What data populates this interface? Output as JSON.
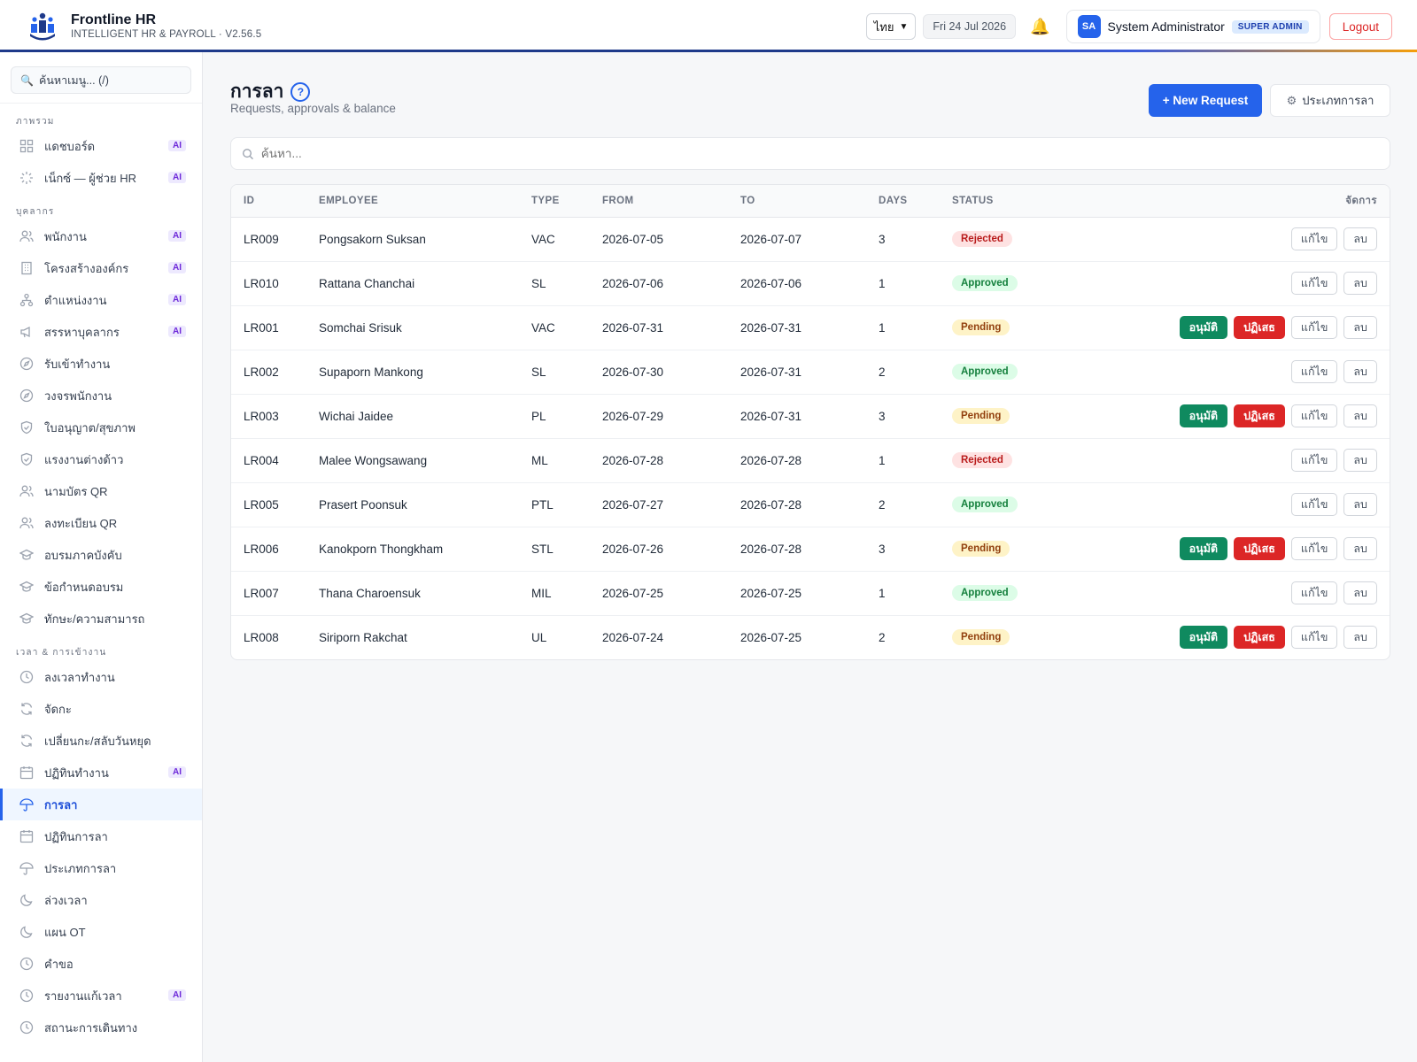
{
  "header": {
    "brand_name": "Frontline HR",
    "brand_sub": "INTELLIGENT HR & PAYROLL · V2.56.5",
    "language": "ไทย",
    "date": "Fri 24 Jul 2026",
    "user_initials": "SA",
    "user_name": "System Administrator",
    "user_role": "SUPER ADMIN",
    "logout": "Logout"
  },
  "sidebar": {
    "search_placeholder": "ค้นหาเมนู... (/)",
    "ai_label": "AI",
    "sections": [
      {
        "title": "ภาพรวม",
        "items": [
          {
            "label": "แดชบอร์ด",
            "icon": "dashboard-icon",
            "ai": true
          },
          {
            "label": "เน็กซ์ — ผู้ช่วย HR",
            "icon": "sparkle-icon",
            "ai": true
          }
        ]
      },
      {
        "title": "บุคลากร",
        "items": [
          {
            "label": "พนักงาน",
            "icon": "users-icon",
            "ai": true
          },
          {
            "label": "โครงสร้างองค์กร",
            "icon": "building-icon",
            "ai": true
          },
          {
            "label": "ตำแหน่งงาน",
            "icon": "org-chart-icon",
            "ai": true
          },
          {
            "label": "สรรหาบุคลากร",
            "icon": "megaphone-icon",
            "ai": true
          },
          {
            "label": "รับเข้าทำงาน",
            "icon": "compass-icon",
            "ai": false
          },
          {
            "label": "วงจรพนักงาน",
            "icon": "compass-icon",
            "ai": false
          },
          {
            "label": "ใบอนุญาต/สุขภาพ",
            "icon": "shield-icon",
            "ai": false
          },
          {
            "label": "แรงงานต่างด้าว",
            "icon": "shield-icon",
            "ai": false
          },
          {
            "label": "นามบัตร QR",
            "icon": "users-icon",
            "ai": false
          },
          {
            "label": "ลงทะเบียน QR",
            "icon": "users-icon",
            "ai": false
          },
          {
            "label": "อบรมภาคบังคับ",
            "icon": "graduation-cap-icon",
            "ai": false
          },
          {
            "label": "ข้อกำหนดอบรม",
            "icon": "graduation-cap-icon",
            "ai": false
          },
          {
            "label": "ทักษะ/ความสามารถ",
            "icon": "graduation-cap-icon",
            "ai": false
          }
        ]
      },
      {
        "title": "เวลา & การเข้างาน",
        "items": [
          {
            "label": "ลงเวลาทำงาน",
            "icon": "clock-icon",
            "ai": false
          },
          {
            "label": "จัดกะ",
            "icon": "refresh-icon",
            "ai": false
          },
          {
            "label": "เปลี่ยนกะ/สลับวันหยุด",
            "icon": "refresh-icon",
            "ai": false
          },
          {
            "label": "ปฏิทินทำงาน",
            "icon": "calendar-icon",
            "ai": true
          },
          {
            "label": "การลา",
            "icon": "umbrella-icon",
            "ai": false,
            "active": true
          },
          {
            "label": "ปฏิทินการลา",
            "icon": "calendar-icon",
            "ai": false
          },
          {
            "label": "ประเภทการลา",
            "icon": "umbrella-icon",
            "ai": false
          },
          {
            "label": "ล่วงเวลา",
            "icon": "moon-icon",
            "ai": false
          },
          {
            "label": "แผน OT",
            "icon": "moon-icon",
            "ai": false
          },
          {
            "label": "คำขอ",
            "icon": "clock-icon",
            "ai": false
          },
          {
            "label": "รายงานแก้เวลา",
            "icon": "clock-icon",
            "ai": true
          },
          {
            "label": "สถานะการเดินทาง",
            "icon": "clock-icon",
            "ai": false
          }
        ]
      }
    ]
  },
  "main": {
    "title": "การลา",
    "subtitle": "Requests, approvals & balance",
    "new_request": "+ New Request",
    "leave_types": "ประเภทการลา",
    "search_placeholder": "ค้นหา...",
    "columns": {
      "id": "ID",
      "employee": "EMPLOYEE",
      "type": "TYPE",
      "from": "FROM",
      "to": "TO",
      "days": "DAYS",
      "status": "STATUS",
      "actions": "จัดการ"
    },
    "action_labels": {
      "approve": "อนุมัติ",
      "reject": "ปฏิเสธ",
      "edit": "แก้ไข",
      "delete": "ลบ"
    },
    "rows": [
      {
        "id": "LR009",
        "employee": "Pongsakorn Suksan",
        "type": "VAC",
        "from": "2026-07-05",
        "to": "2026-07-07",
        "days": "3",
        "status": "Rejected"
      },
      {
        "id": "LR010",
        "employee": "Rattana Chanchai",
        "type": "SL",
        "from": "2026-07-06",
        "to": "2026-07-06",
        "days": "1",
        "status": "Approved"
      },
      {
        "id": "LR001",
        "employee": "Somchai Srisuk",
        "type": "VAC",
        "from": "2026-07-31",
        "to": "2026-07-31",
        "days": "1",
        "status": "Pending"
      },
      {
        "id": "LR002",
        "employee": "Supaporn Mankong",
        "type": "SL",
        "from": "2026-07-30",
        "to": "2026-07-31",
        "days": "2",
        "status": "Approved"
      },
      {
        "id": "LR003",
        "employee": "Wichai Jaidee",
        "type": "PL",
        "from": "2026-07-29",
        "to": "2026-07-31",
        "days": "3",
        "status": "Pending"
      },
      {
        "id": "LR004",
        "employee": "Malee Wongsawang",
        "type": "ML",
        "from": "2026-07-28",
        "to": "2026-07-28",
        "days": "1",
        "status": "Rejected"
      },
      {
        "id": "LR005",
        "employee": "Prasert Poonsuk",
        "type": "PTL",
        "from": "2026-07-27",
        "to": "2026-07-28",
        "days": "2",
        "status": "Approved"
      },
      {
        "id": "LR006",
        "employee": "Kanokporn Thongkham",
        "type": "STL",
        "from": "2026-07-26",
        "to": "2026-07-28",
        "days": "3",
        "status": "Pending"
      },
      {
        "id": "LR007",
        "employee": "Thana Charoensuk",
        "type": "MIL",
        "from": "2026-07-25",
        "to": "2026-07-25",
        "days": "1",
        "status": "Approved"
      },
      {
        "id": "LR008",
        "employee": "Siriporn Rakchat",
        "type": "UL",
        "from": "2026-07-24",
        "to": "2026-07-25",
        "days": "2",
        "status": "Pending"
      }
    ]
  },
  "colors": {
    "accent": "#2563eb",
    "approve": "#0f8a5f",
    "reject": "#dc2626"
  }
}
